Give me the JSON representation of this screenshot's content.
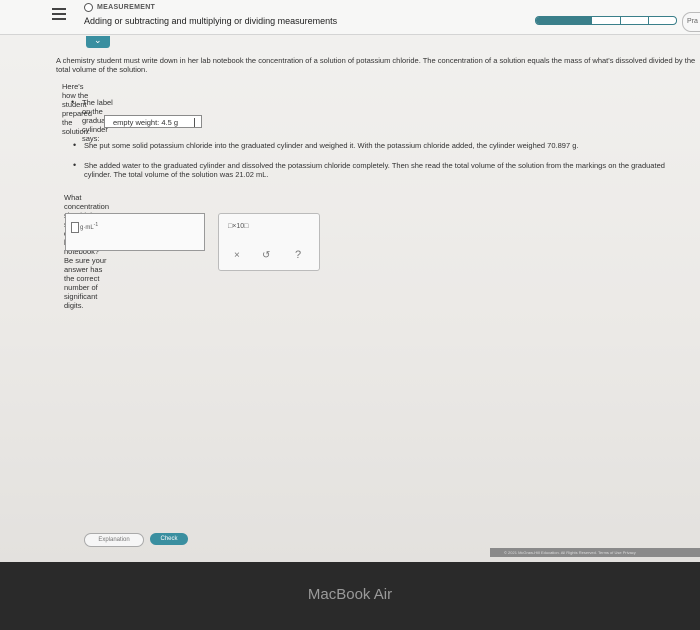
{
  "header": {
    "topic": "MEASUREMENT",
    "title": "Adding or subtracting and multiplying or dividing measurements",
    "progress_fraction": 0.4,
    "next_tab_label": "Pra"
  },
  "problem": {
    "intro": "A chemistry student must write down in her lab notebook the concentration of a solution of potassium chloride. The concentration of a solution equals the mass of what's dissolved divided by the total volume of the solution.",
    "prep_heading": "Here's how the student prepared the solution:",
    "bullet1": "The label on the graduated cylinder says:",
    "label_text": "empty weight: 4.5 g",
    "bullet2": "She put some solid potassium chloride into the graduated cylinder and weighed it. With the potassium chloride added, the cylinder weighed 70.897 g.",
    "bullet3": "She added water to the graduated cylinder and dissolved the potassium chloride completely. Then she read the total volume of the solution from the markings on the graduated cylinder. The total volume of the solution was 21.02 mL.",
    "question": "What concentration should the student write down in her lab notebook? Be sure your answer has the correct number of significant digits."
  },
  "answer": {
    "unit": "g·mL",
    "unit_exp": "-1"
  },
  "tools": {
    "sci_notation": "□×10□",
    "clear": "×",
    "undo": "↺",
    "help": "?"
  },
  "footer": {
    "explanation": "Explanation",
    "check": "Check",
    "copyright": "© 2021 McGraw-Hill Education. All Rights Reserved.   Terms of Use   Privacy"
  },
  "device": {
    "brand": "MacBook Air"
  },
  "colors": {
    "accent": "#3a8fa0"
  }
}
